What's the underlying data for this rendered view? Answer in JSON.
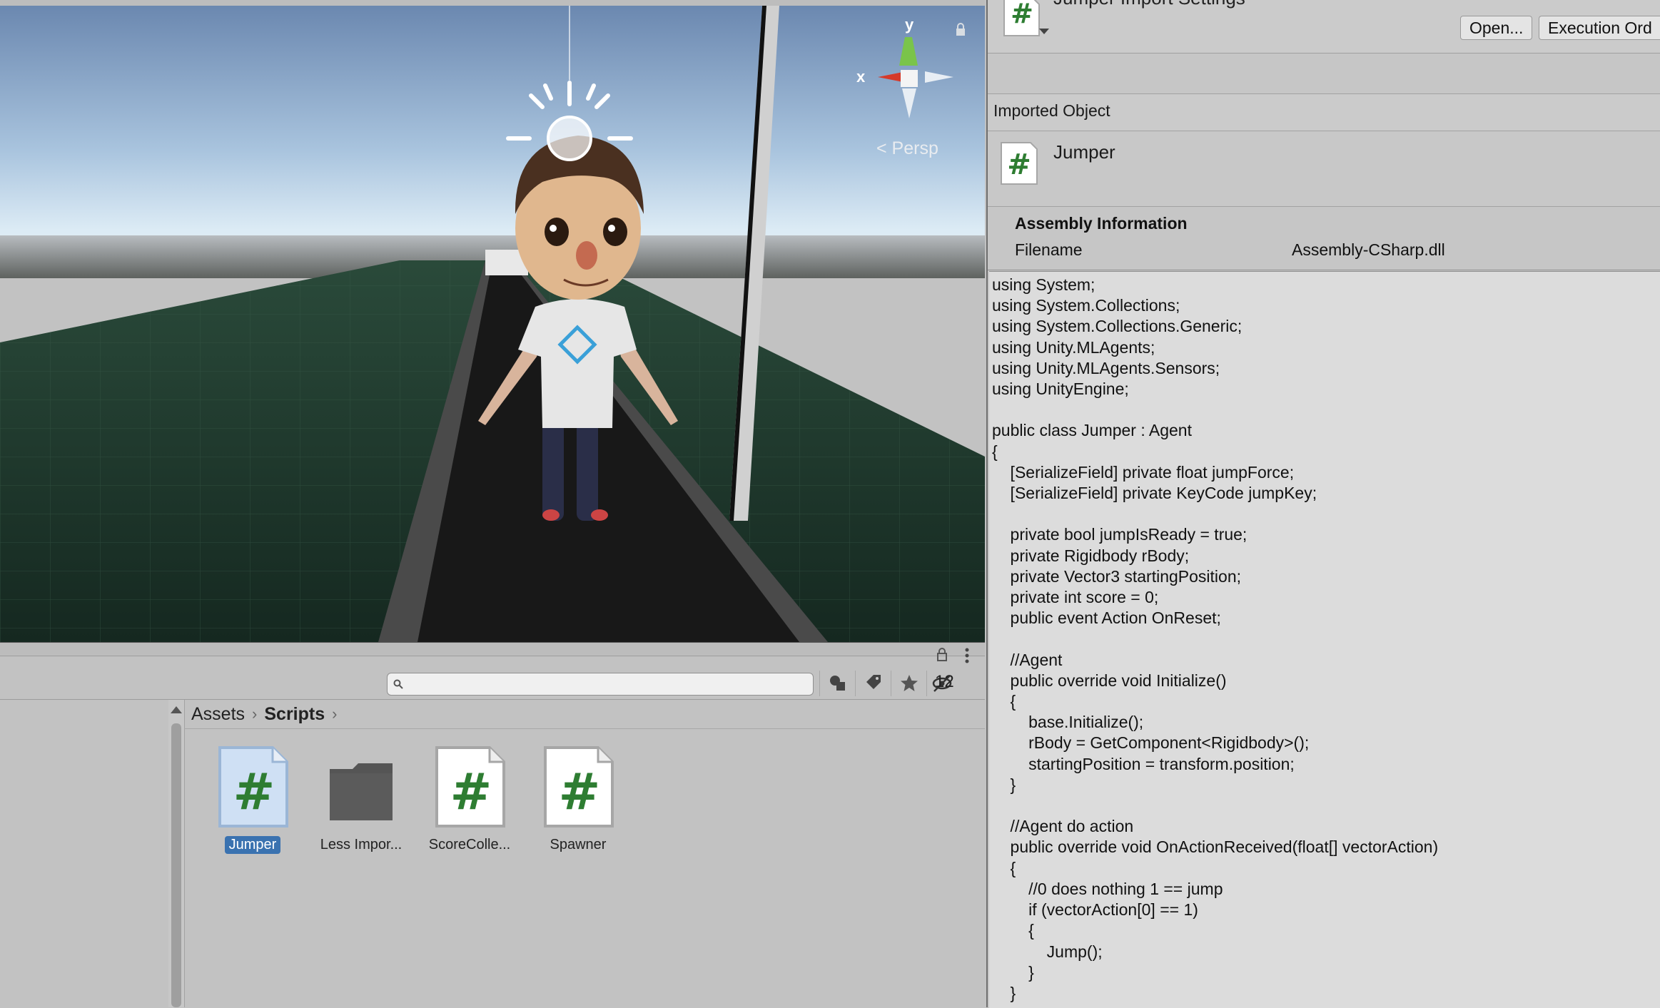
{
  "inspector": {
    "title": "Jumper Import Settings",
    "open_button": "Open...",
    "execution_order_button": "Execution Ord",
    "imported_object_header": "Imported Object",
    "imported_object_name": "Jumper",
    "assembly_info_title": "Assembly Information",
    "filename_label": "Filename",
    "filename_value": "Assembly-CSharp.dll",
    "code_lines": [
      "using System;",
      "using System.Collections;",
      "using System.Collections.Generic;",
      "using Unity.MLAgents;",
      "using Unity.MLAgents.Sensors;",
      "using UnityEngine;",
      "",
      "public class Jumper : Agent",
      "{",
      "    [SerializeField] private float jumpForce;",
      "    [SerializeField] private KeyCode jumpKey;",
      "",
      "    private bool jumpIsReady = true;",
      "    private Rigidbody rBody;",
      "    private Vector3 startingPosition;",
      "    private int score = 0;",
      "    public event Action OnReset;",
      "",
      "    //Agent",
      "    public override void Initialize()",
      "    {",
      "        base.Initialize();",
      "        rBody = GetComponent<Rigidbody>();",
      "        startingPosition = transform.position;",
      "    }",
      "",
      "    //Agent do action",
      "    public override void OnActionReceived(float[] vectorAction)",
      "    {",
      "        //0 does nothing 1 == jump",
      "        if (vectorAction[0] == 1)",
      "        {",
      "            Jump();",
      "        }",
      "    }"
    ]
  },
  "scene": {
    "gizmo_y": "y",
    "gizmo_x": "x",
    "projection_label": "< Persp"
  },
  "project": {
    "hidden_count": "12",
    "search_placeholder": "",
    "breadcrumb": [
      "Assets",
      "Scripts"
    ],
    "assets": [
      {
        "label": "Jumper",
        "type": "script",
        "selected": true
      },
      {
        "label": "Less Impor...",
        "type": "folder",
        "selected": false
      },
      {
        "label": "ScoreColle...",
        "type": "script",
        "selected": false
      },
      {
        "label": "Spawner",
        "type": "script",
        "selected": false
      }
    ]
  },
  "icons": {
    "script": "csharp-script-icon",
    "folder": "folder-icon",
    "search": "search-icon",
    "lock": "lock-icon",
    "kebab": "kebab-menu-icon"
  },
  "colors": {
    "script_hash": "#2e7d32",
    "selection": "#3a72b0",
    "sky_top": "#6f8cb4",
    "sky_horizon": "#d8e8f4",
    "ground": "#1d3228"
  }
}
